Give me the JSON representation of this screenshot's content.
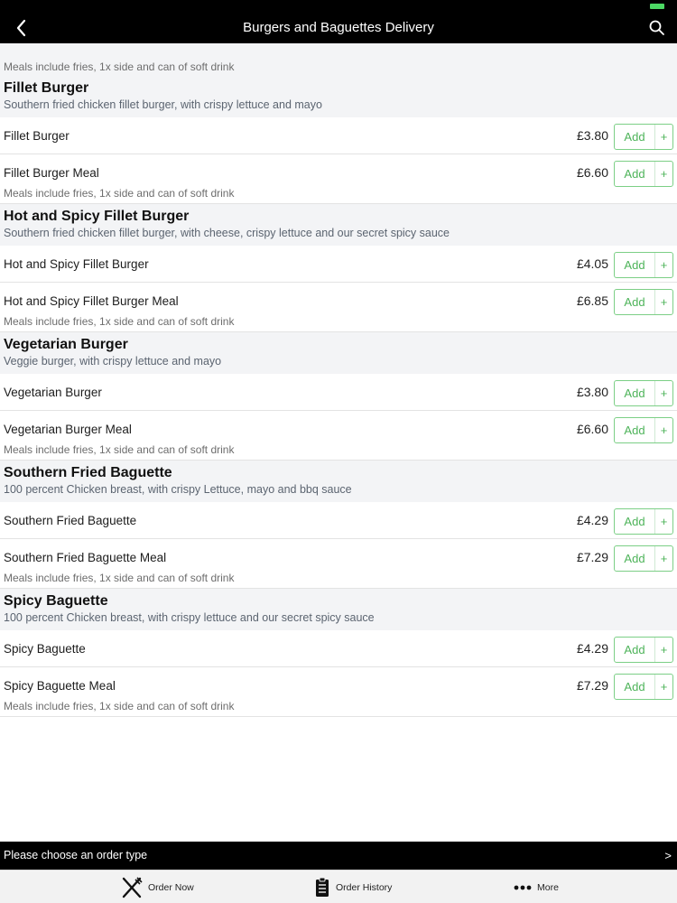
{
  "header": {
    "title": "Burgers and Baguettes Delivery"
  },
  "intro_note": "Meals include fries, 1x side and can of soft drink",
  "add_label": "Add",
  "plus_label": "+",
  "categories": [
    {
      "title": "Fillet Burger",
      "description": "Southern fried chicken fillet burger, with crispy lettuce and mayo",
      "items": [
        {
          "name": "Fillet Burger",
          "price": "£3.80"
        },
        {
          "name": "Fillet Burger Meal",
          "price": "£6.60",
          "note": "Meals include fries, 1x side and can of soft drink"
        }
      ]
    },
    {
      "title": "Hot and Spicy Fillet Burger",
      "description": "Southern fried chicken fillet burger, with cheese, crispy lettuce and our secret spicy sauce",
      "items": [
        {
          "name": "Hot and Spicy Fillet Burger",
          "price": "£4.05"
        },
        {
          "name": "Hot and Spicy Fillet Burger Meal",
          "price": "£6.85",
          "note": "Meals include fries, 1x side and can of soft drink"
        }
      ]
    },
    {
      "title": "Vegetarian Burger",
      "description": "Veggie burger, with crispy lettuce and mayo",
      "items": [
        {
          "name": "Vegetarian Burger",
          "price": "£3.80"
        },
        {
          "name": "Vegetarian Burger Meal",
          "price": "£6.60",
          "note": "Meals include fries, 1x side and can of soft drink"
        }
      ]
    },
    {
      "title": "Southern Fried Baguette",
      "description": "100 percent Chicken breast, with crispy Lettuce, mayo and bbq sauce",
      "items": [
        {
          "name": "Southern Fried Baguette",
          "price": "£4.29"
        },
        {
          "name": "Southern Fried Baguette Meal",
          "price": "£7.29",
          "note": "Meals include fries, 1x side and can of soft drink"
        }
      ]
    },
    {
      "title": "Spicy Baguette",
      "description": "100 percent Chicken breast, with crispy lettuce and our secret spicy sauce",
      "items": [
        {
          "name": "Spicy Baguette",
          "price": "£4.29"
        },
        {
          "name": "Spicy Baguette Meal",
          "price": "£7.29",
          "note": "Meals include fries, 1x side and can of soft drink"
        }
      ]
    }
  ],
  "order_bar": {
    "text": "Please choose an order type",
    "chevron": ">"
  },
  "tabs": [
    {
      "label": "Order Now",
      "icon": "fork-knife-icon"
    },
    {
      "label": "Order History",
      "icon": "clipboard-icon"
    },
    {
      "label": "More",
      "icon": "more-dots-icon"
    }
  ],
  "colors": {
    "accent": "#4db359",
    "bar": "#000000",
    "section_bg": "#f3f4f6"
  }
}
